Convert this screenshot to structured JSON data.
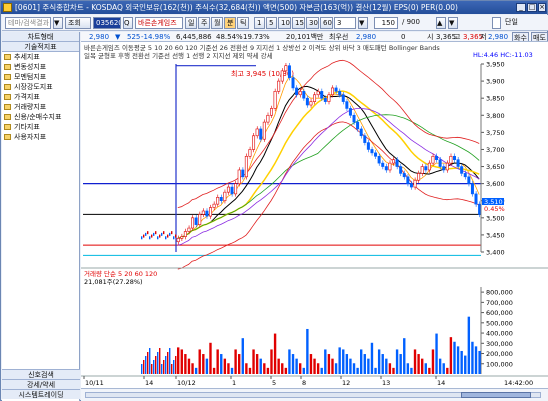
{
  "titlebar": {
    "title": "[0601] 주식종합차트 - KOSDAQ 외국인보유(162(천)) 주식수(32,684(천)) 액면(500) 자본금(163(억)) 결산(12월) EPS(0) PER(0.00)"
  },
  "toolbar": {
    "search_placeholder": "테마/검색결과",
    "search_label": "조회",
    "code": "035620",
    "company": "바른손게임즈",
    "period_day": "일",
    "period_week": "주",
    "period_month": "월",
    "period_minute": "분",
    "period_tick": "틱",
    "ticks": [
      "1",
      "5",
      "10",
      "15",
      "30",
      "60",
      "3"
    ],
    "count": "150",
    "total": "/ 900",
    "single_label": "단일"
  },
  "sidebar": {
    "header": "차트형태",
    "section": "기술적지표",
    "items": [
      "추세지표",
      "변동성지표",
      "모멘텀지표",
      "시장강도지표",
      "가격지표",
      "거래량지표",
      "신용/순매수지표",
      "기타지표",
      "사용자지표"
    ],
    "footer": [
      "신호검색",
      "강세/약세",
      "시스템트레이딩"
    ]
  },
  "infobar": {
    "price": "2,980",
    "down_arrow": "▼",
    "change": "525",
    "rate": "-14.98%",
    "volume": "6,445,886",
    "vol_ratio": "48.54%",
    "turnover": "19.73%",
    "amount": "20,101백만",
    "min": "최우선",
    "bid": "2,980",
    "zero": "0",
    "ask_label": "시",
    "ask": "3,365",
    "high_label": "고",
    "high": "3,365",
    "low_label": "저",
    "low": "2,980",
    "btn_1": "화수",
    "btn_2": "매도"
  },
  "chart_data": {
    "type": "candlestick",
    "legend_top": "바른손게임즈 이동평균 5 10 20 60 120 기준선 26 전환선 9 지지선 1 상방선 2 이격도 상위 바닥 3 매도패턴 Bollinger Bands",
    "legend_line2": "일목 균형표 후행 전환선 기준선 선행 1 선행 2 지지선 제외 약세 강세",
    "annotation": "최고 3,945 (10/30)",
    "y_min": 3400,
    "y_max": 3950,
    "y_ticks": [
      "3,950",
      "3,900",
      "3,850",
      "3,800",
      "3,750",
      "3,700",
      "3,650",
      "3,600",
      "3,550",
      "3,500",
      "3,450",
      "3,400"
    ],
    "price_labels": [
      "3,510",
      "0.45%"
    ],
    "corner_text": "HL:4.46 HC:-11.03",
    "volume_legend": "거래량 단순 5 20 60 120",
    "volume_value": "21,081주(27.28%)",
    "volume_ticks": [
      "800,000",
      "700,000",
      "600,000",
      "500,000",
      "400,000",
      "300,000",
      "200,000",
      "100,000"
    ],
    "x_labels": [
      "10/11",
      "14",
      "10/12",
      "1",
      "5",
      "8",
      "12",
      "13",
      "14"
    ],
    "time_label": "14:42:00"
  },
  "colors": {
    "bg": "#ffffff",
    "up": "#e00000",
    "down": "#0060ff",
    "ma_yellow": "#ffd000",
    "ma_black": "#000000",
    "bb": "#e02020"
  }
}
